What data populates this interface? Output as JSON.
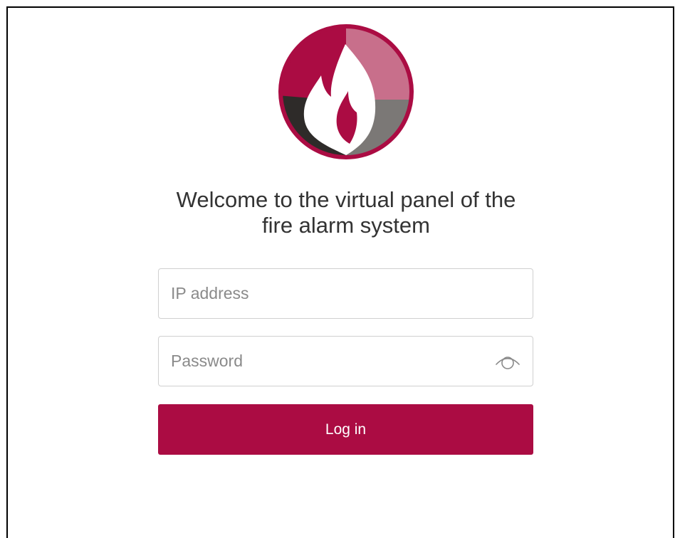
{
  "header": {
    "logo_icon": "fire-logo-icon",
    "welcome_line1": "Welcome to the virtual panel of the",
    "welcome_line2": "fire alarm system"
  },
  "form": {
    "ip_field": {
      "placeholder": "IP address",
      "value": ""
    },
    "password_field": {
      "placeholder": "Password",
      "value": "",
      "toggle_icon": "eye-icon"
    },
    "login_label": "Log in"
  },
  "colors": {
    "brand": "#ab0c43",
    "brand_light": "#c86f8b",
    "dark_segment": "#2e2b29",
    "grey_segment": "#7b7876",
    "text": "#333333",
    "placeholder": "#8a8a8a",
    "border": "#d0d0d0"
  }
}
